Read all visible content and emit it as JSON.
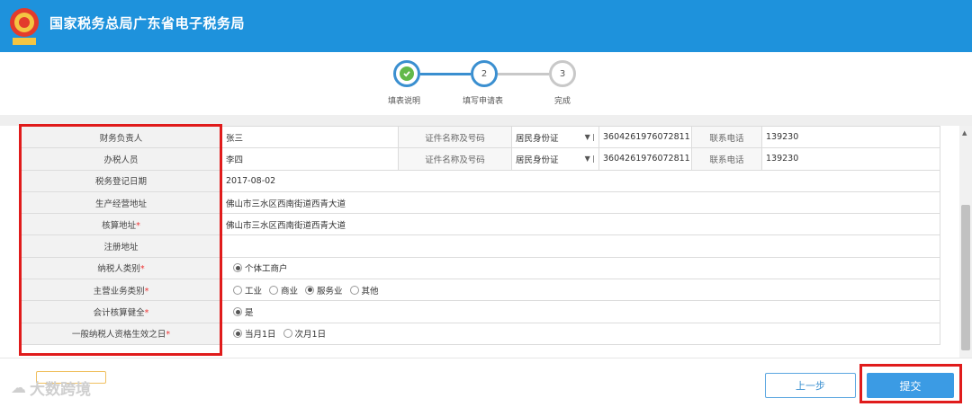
{
  "header": {
    "title": "国家税务总局广东省电子税务局",
    "emblem_icon": "tax-emblem-icon"
  },
  "stepper": {
    "steps": [
      {
        "number": "",
        "label": "填表说明",
        "state": "done"
      },
      {
        "number": "2",
        "label": "填写申请表",
        "state": "active"
      },
      {
        "number": "3",
        "label": "完成",
        "state": "pending"
      }
    ]
  },
  "form": {
    "rows": [
      {
        "label": "财务负责人",
        "required": false,
        "value": "张三",
        "id_label": "证件名称及号码",
        "id_type": "居民身份证",
        "id_number": "3604261976072811",
        "phone_label": "联系电话",
        "phone": "139230"
      },
      {
        "label": "办税人员",
        "required": false,
        "value": "李四",
        "id_label": "证件名称及号码",
        "id_type": "居民身份证",
        "id_number": "3604261976072811",
        "phone_label": "联系电话",
        "phone": "139230"
      },
      {
        "label": "税务登记日期",
        "required": false,
        "value": "2017-08-02"
      },
      {
        "label": "生产经营地址",
        "required": false,
        "value": "佛山市三水区西南街道西青大道"
      },
      {
        "label": "核算地址",
        "required": true,
        "value": "佛山市三水区西南街道西青大道"
      },
      {
        "label": "注册地址",
        "required": false,
        "value": ""
      },
      {
        "label": "纳税人类别",
        "required": true,
        "options": [
          "个体工商户"
        ],
        "selected": 0
      },
      {
        "label": "主营业务类别",
        "required": true,
        "options": [
          "工业",
          "商业",
          "服务业",
          "其他"
        ],
        "selected": 2
      },
      {
        "label": "会计核算健全",
        "required": true,
        "options": [
          "是"
        ],
        "selected": 0
      },
      {
        "label": "一般纳税人资格生效之日",
        "required": true,
        "options": [
          "当月1日",
          "次月1日"
        ],
        "selected": 0
      }
    ]
  },
  "footer": {
    "prev_label": "上一步",
    "submit_label": "提交",
    "watermark": "大数跨境"
  }
}
